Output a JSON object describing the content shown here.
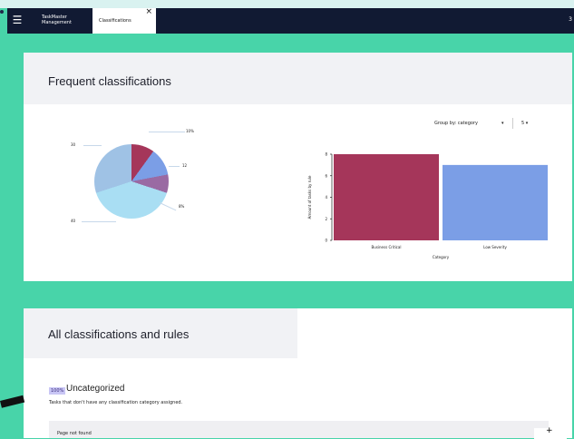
{
  "header": {
    "app_name_line1": "TaskMaster",
    "app_name_line2": "Management",
    "active_tab_label": "Classifications",
    "tab_close": "×",
    "menu_icon": "hamburger-icon",
    "right_mark": "3"
  },
  "frequent": {
    "title": "Frequent classifications",
    "group_by_label": "Group by: category",
    "group_by_caret": "▾",
    "sort_label": "5 ▾"
  },
  "pie_chart": {
    "type": "pie",
    "slices": [
      {
        "value": 10,
        "color": "#a5365a",
        "label": "10%"
      },
      {
        "value": 12,
        "color": "#7b9ee6",
        "label": "12"
      },
      {
        "value": 8,
        "color": "#9a6aa3",
        "label": "8%"
      },
      {
        "value": 40,
        "color": "#a9def3",
        "label": "40"
      },
      {
        "value": 30,
        "color": "#9fc2e5",
        "label": "30"
      }
    ]
  },
  "chart_data": {
    "type": "bar",
    "categories": [
      "Business Critical",
      "Low Severity"
    ],
    "values": [
      8,
      7
    ],
    "colors": [
      "#a5365a",
      "#7b9ee6"
    ],
    "ylabel": "Amount of tasks by rule",
    "xlabel": "Category",
    "ylim": [
      0,
      8
    ],
    "yticks": [
      0,
      2,
      4,
      6,
      8
    ]
  },
  "all_rules": {
    "title": "All classifications and rules",
    "badge": "100%",
    "category_title": "Uncategorized",
    "category_desc": "Tasks that don't have any classification category assigned.",
    "rule_label": "Page not found",
    "rule_button": "+"
  }
}
